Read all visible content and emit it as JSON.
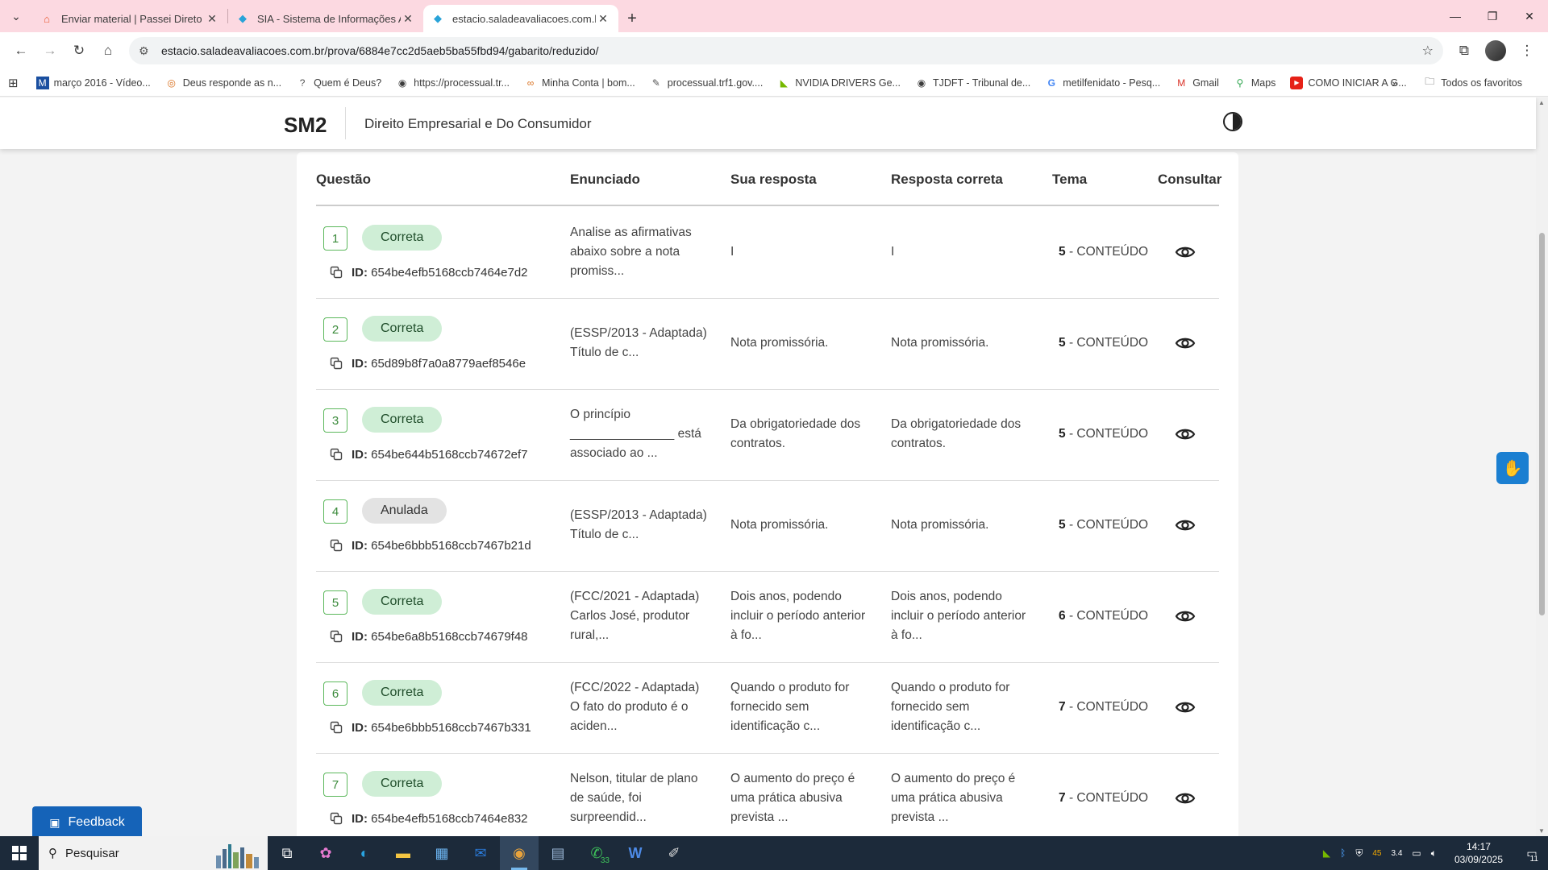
{
  "browser": {
    "tabs": [
      {
        "title": "Enviar material | Passei Direto",
        "active": false
      },
      {
        "title": "SIA - Sistema de Informações Ac",
        "active": false
      },
      {
        "title": "estacio.saladeavaliacoes.com.br",
        "active": true
      }
    ],
    "url": "estacio.saladeavaliacoes.com.br/prova/6884e7cc2d5aeb5ba55fbd94/gabarito/reduzido/",
    "bookmarks": [
      "março 2016 - Vídeo...",
      "Deus responde as n...",
      "Quem é Deus?",
      "https://processual.tr...",
      "Minha Conta | bom...",
      "processual.trf1.gov....",
      "NVIDIA DRIVERS Ge...",
      "TJDFT - Tribunal de...",
      "metilfenidato - Pesq...",
      "Gmail",
      "Maps",
      "COMO INICIAR A G..."
    ],
    "all_bookmarks": "Todos os favoritos"
  },
  "header": {
    "logo": "SM2",
    "course": "Direito Empresarial e Do Consumidor"
  },
  "table": {
    "headers": {
      "questao": "Questão",
      "enunciado": "Enunciado",
      "sua_resposta": "Sua resposta",
      "resposta_correta": "Resposta correta",
      "tema": "Tema",
      "consultar": "Consultar"
    },
    "id_label": "ID:",
    "rows": [
      {
        "num": "1",
        "status": "Correta",
        "id": "654be4efb5168ccb7464e7d2",
        "enunciado": "Analise as afirmativas abaixo sobre a nota promiss...",
        "sua": "I",
        "correta": "I",
        "tema_num": "5",
        "tema_txt": "- CONTEÚDO"
      },
      {
        "num": "2",
        "status": "Correta",
        "id": "65d89b8f7a0a8779aef8546e",
        "enunciado": "(ESSP/2013 - Adaptada)   Título de c...",
        "sua": "Nota promissória.",
        "correta": "Nota promissória.",
        "tema_num": "5",
        "tema_txt": "- CONTEÚDO"
      },
      {
        "num": "3",
        "status": "Correta",
        "id": "654be644b5168ccb74672ef7",
        "enunciado": "O princípio _______________ está associado ao ...",
        "sua": "Da obrigatoriedade dos contratos.",
        "correta": "Da obrigatoriedade dos contratos.",
        "tema_num": "5",
        "tema_txt": "- CONTEÚDO"
      },
      {
        "num": "4",
        "status": "Anulada",
        "id": "654be6bbb5168ccb7467b21d",
        "enunciado": "(ESSP/2013 - Adaptada)   Título de c...",
        "sua": "Nota promissória.",
        "correta": "Nota promissória.",
        "tema_num": "5",
        "tema_txt": "- CONTEÚDO"
      },
      {
        "num": "5",
        "status": "Correta",
        "id": "654be6a8b5168ccb74679f48",
        "enunciado": "(FCC/2021 - Adaptada) Carlos José, produtor rural,...",
        "sua": "Dois anos, podendo incluir o período anterior à fo...",
        "correta": "Dois anos, podendo incluir o período anterior à fo...",
        "tema_num": "6",
        "tema_txt": "- CONTEÚDO"
      },
      {
        "num": "6",
        "status": "Correta",
        "id": "654be6bbb5168ccb7467b331",
        "enunciado": "(FCC/2022 - Adaptada) O fato do produto é o aciden...",
        "sua": "Quando o produto for fornecido sem identificação c...",
        "correta": "Quando o produto for fornecido sem identificação c...",
        "tema_num": "7",
        "tema_txt": "- CONTEÚDO"
      },
      {
        "num": "7",
        "status": "Correta",
        "id": "654be4efb5168ccb7464e832",
        "enunciado": "Nelson, titular de plano de saúde, foi surpreendid...",
        "sua": "O aumento do preço é uma prática abusiva prevista ...",
        "correta": "O aumento do preço é uma prática abusiva prevista ...",
        "tema_num": "7",
        "tema_txt": "- CONTEÚDO"
      }
    ]
  },
  "feedback_label": "Feedback",
  "taskbar": {
    "search_placeholder": "Pesquisar",
    "whatsapp_badge": "33",
    "temp": "45",
    "net": "3.4",
    "time": "14:17",
    "date": "03/09/2025",
    "notif_count": "11"
  },
  "colors": {
    "tabstrip": "#fcd9e1",
    "correct_badge": "#cfeed6",
    "void_badge": "#e3e3e3",
    "feedback": "#1563b8",
    "qnum_border": "#5cb85c"
  }
}
